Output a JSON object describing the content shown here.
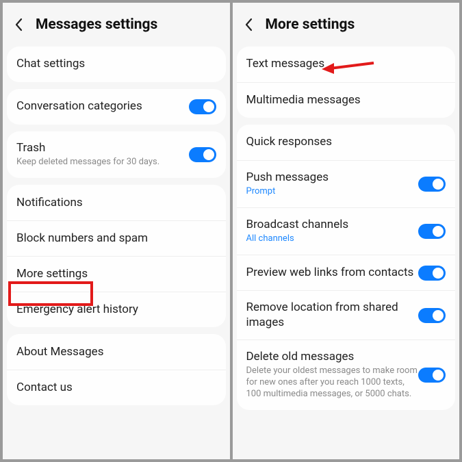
{
  "left": {
    "title": "Messages settings",
    "chat_settings": "Chat settings",
    "conversation_categories": "Conversation categories",
    "trash_title": "Trash",
    "trash_sub": "Keep deleted messages for 30 days.",
    "notifications": "Notifications",
    "block": "Block numbers and spam",
    "more_settings": "More settings",
    "emergency": "Emergency alert history",
    "about": "About Messages",
    "contact": "Contact us"
  },
  "right": {
    "title": "More settings",
    "text_messages": "Text messages",
    "multimedia": "Multimedia messages",
    "quick_responses": "Quick responses",
    "push_title": "Push messages",
    "push_sub": "Prompt",
    "broadcast_title": "Broadcast channels",
    "broadcast_sub": "All channels",
    "preview": "Preview web links from contacts",
    "remove_location": "Remove location from shared images",
    "delete_old_title": "Delete old messages",
    "delete_old_sub": "Delete your oldest messages to make room for new ones after you reach 1000 texts, 100 multimedia messages, or 5000 chats."
  }
}
